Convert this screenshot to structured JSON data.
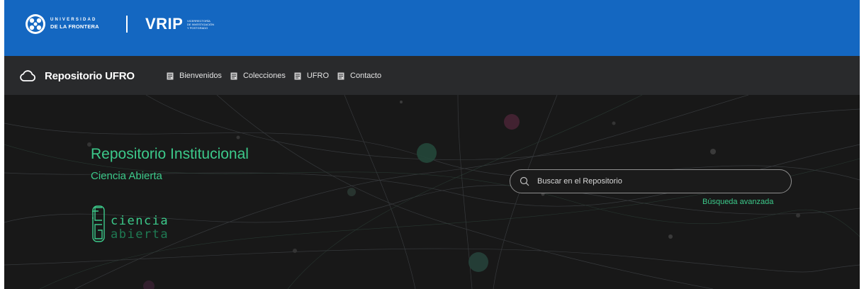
{
  "header": {
    "university_line1": "UNIVERSIDAD",
    "university_line2": "DE LA FRONTERA",
    "vrip": "VRIP",
    "vrip_sub1": "VICERRECTORÍA",
    "vrip_sub2": "DE INVESTIGACIÓN",
    "vrip_sub3": "Y POSTGRADO",
    "logo_icon": "university-seal-icon",
    "background_color": "#1467c1"
  },
  "nav": {
    "brand": "Repositorio UFRO",
    "brand_icon": "cloud-icon",
    "item_icon": "document-icon",
    "items": [
      {
        "label": "Bienvenidos"
      },
      {
        "label": "Colecciones"
      },
      {
        "label": "UFRO"
      },
      {
        "label": "Contacto"
      }
    ],
    "background_color": "#292a2c"
  },
  "hero": {
    "title": "Repositorio Institucional",
    "subtitle": "Ciencia Abierta",
    "logo_line1": "ciencia",
    "logo_line2": "abierta",
    "search": {
      "placeholder": "Buscar en el Repositorio",
      "value": "",
      "icon": "search-icon"
    },
    "advanced_search": "Búsqueda avanzada",
    "accent_color": "#3cc98a",
    "background_color": "#181818"
  }
}
